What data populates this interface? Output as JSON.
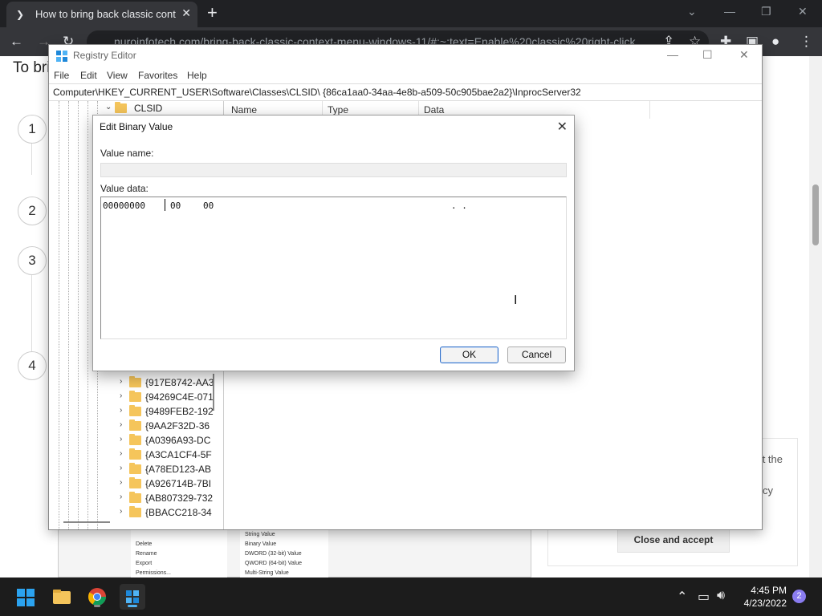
{
  "browser": {
    "tab_title": "How to bring back classic contex",
    "url": "nuroinfotech.com/bring-back-classic-context-menu-windows-11/#:~:text=Enable%20classic%20right-click"
  },
  "page": {
    "heading": "To brin",
    "steps": [
      "1",
      "2",
      "3",
      "4"
    ],
    "cookie_line1": "t the",
    "cookie_line2": "acy",
    "cookie_accept": "Close and accept",
    "context_menu": [
      "Delete",
      "Rename",
      "Export",
      "Permissions..."
    ],
    "context_submenu": [
      "String Value",
      "Binary Value",
      "DWORD (32-bit) Value",
      "QWORD (64-bit) Value",
      "Multi-String Value"
    ]
  },
  "regedit": {
    "title": "Registry Editor",
    "menu": [
      "File",
      "Edit",
      "View",
      "Favorites",
      "Help"
    ],
    "address": "Computer\\HKEY_CURRENT_USER\\Software\\Classes\\CLSID\\ {86ca1aa0-34aa-4e8b-a509-50c905bae2a2}\\InprocServer32",
    "tree_root": "CLSID",
    "tree_items": [
      "{917E8742-AA3",
      "{94269C4E-071",
      "{9489FEB2-192",
      "{9AA2F32D-36",
      "{A0396A93-DC",
      "{A3CA1CF4-5F",
      "{A78ED123-AB",
      "{A926714B-7BI",
      "{AB807329-732",
      "{BBACC218-34"
    ],
    "columns": [
      "Name",
      "Type",
      "Data"
    ]
  },
  "dialog": {
    "title": "Edit Binary Value",
    "value_name_label": "Value name:",
    "value_name": "",
    "value_data_label": "Value data:",
    "address": "00000000",
    "hex1": "00",
    "hex2": "00",
    "ascii": ". .",
    "ok": "OK",
    "cancel": "Cancel"
  },
  "taskbar": {
    "time": "4:45 PM",
    "date": "4/23/2022",
    "notifications": "2"
  },
  "colors": {
    "folder": "#f5c55b",
    "accent": "#2f6fc9",
    "taskbar": "#1c1c1c"
  }
}
